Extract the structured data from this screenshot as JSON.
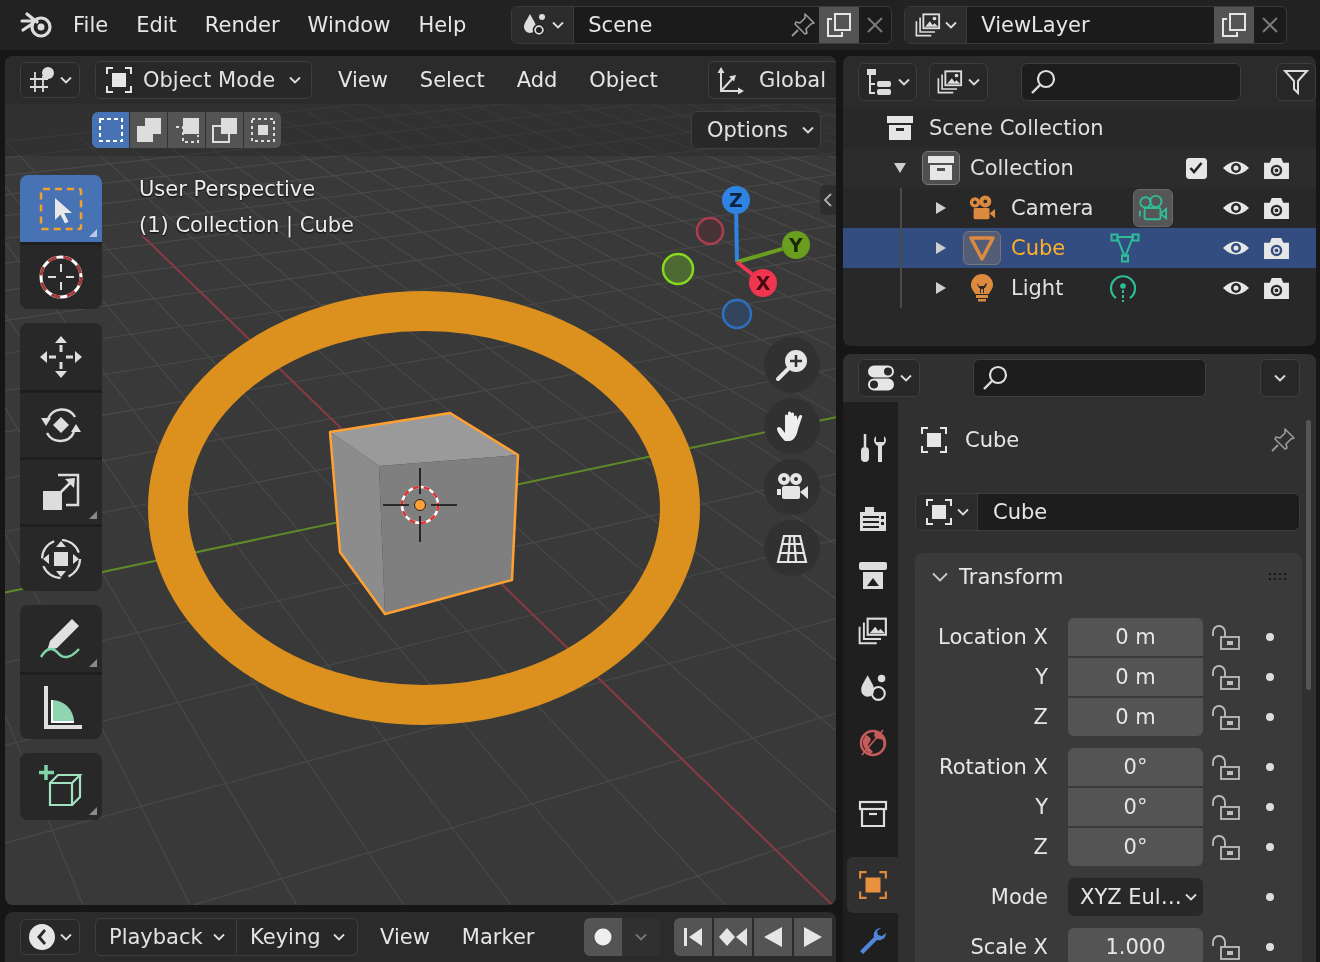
{
  "topbar": {
    "menu": [
      "File",
      "Edit",
      "Render",
      "Window",
      "Help"
    ],
    "scene": {
      "name": "Scene"
    },
    "view_layer": {
      "name": "ViewLayer"
    }
  },
  "viewport": {
    "header": {
      "mode": "Object Mode",
      "menu": [
        "View",
        "Select",
        "Add",
        "Object"
      ],
      "orientation": "Global"
    },
    "select_modes": [
      {
        "kind": "set",
        "selected": true
      },
      {
        "kind": "extend",
        "selected": false
      },
      {
        "kind": "subtract",
        "selected": false
      },
      {
        "kind": "invert",
        "selected": false
      },
      {
        "kind": "intersect",
        "selected": false
      }
    ],
    "options": "Options",
    "view_name": "User Perspective",
    "object_info": "(1) Collection | Cube",
    "tool_groups": [
      {
        "tools": [
          {
            "kind": "select_box",
            "selected": true,
            "more": true
          },
          {
            "kind": "cursor",
            "selected": false,
            "more": false
          }
        ]
      },
      {
        "tools": [
          {
            "kind": "move",
            "selected": false,
            "more": false
          },
          {
            "kind": "rotate",
            "selected": false,
            "more": false
          },
          {
            "kind": "scale",
            "selected": false,
            "more": true
          },
          {
            "kind": "transform",
            "selected": false,
            "more": false
          }
        ]
      },
      {
        "tools": [
          {
            "kind": "annotate",
            "selected": false,
            "more": true
          },
          {
            "kind": "measure",
            "selected": false,
            "more": false
          }
        ]
      },
      {
        "tools": [
          {
            "kind": "add_cube",
            "selected": false,
            "more": true
          }
        ]
      }
    ],
    "gizmo": [
      {
        "kind": "z",
        "label": "Z"
      },
      {
        "kind": "y",
        "label": "Y"
      },
      {
        "kind": "x",
        "label": "X"
      }
    ]
  },
  "timeline": {
    "menus": [
      {
        "label": "Playback",
        "kind": "dropdown"
      },
      {
        "label": "Keying",
        "kind": "dropdown"
      },
      {
        "label": "View",
        "kind": "menu"
      },
      {
        "label": "Marker",
        "kind": "menu"
      }
    ],
    "auto_keying": {
      "on": false
    },
    "transport": [
      {
        "kind": "jump_start"
      },
      {
        "kind": "jump_keyframe"
      },
      {
        "kind": "play_reverse"
      },
      {
        "kind": "play"
      }
    ]
  },
  "outliner": {
    "root": {
      "label": "Scene Collection",
      "selected": false,
      "children": [
        {
          "label": "Collection",
          "kind": "collection",
          "expanded": true,
          "checked": true,
          "selected": false,
          "active": true,
          "children": [
            {
              "label": "Camera",
              "kind": "camera",
              "expanded": false,
              "selected": false,
              "active": false,
              "data_active": true
            },
            {
              "label": "Cube",
              "kind": "mesh",
              "expanded": false,
              "selected": true,
              "active": true,
              "data_active": false
            },
            {
              "label": "Light",
              "kind": "light",
              "expanded": false,
              "selected": false,
              "active": false,
              "data_active": false
            }
          ]
        }
      ]
    }
  },
  "properties": {
    "tab_groups": [
      {
        "tabs": [
          {
            "kind": "tool",
            "selected": false
          }
        ]
      },
      {
        "tabs": [
          {
            "kind": "render",
            "selected": false
          },
          {
            "kind": "output",
            "selected": false
          },
          {
            "kind": "view_layer",
            "selected": false
          },
          {
            "kind": "scene",
            "selected": false
          },
          {
            "kind": "world",
            "selected": false
          }
        ]
      },
      {
        "tabs": [
          {
            "kind": "collection",
            "selected": false
          }
        ]
      },
      {
        "tabs": [
          {
            "kind": "object",
            "selected": true
          },
          {
            "kind": "modifiers",
            "selected": false
          }
        ]
      }
    ],
    "context": "Cube",
    "name_field": "Cube",
    "panel": {
      "title": "Transform",
      "expanded": true,
      "groups": [
        {
          "rows": [
            {
              "label": "Location X",
              "value": "0 m",
              "kind": "number",
              "locked": false
            },
            {
              "label": "Y",
              "value": "0 m",
              "kind": "number",
              "locked": false
            },
            {
              "label": "Z",
              "value": "0 m",
              "kind": "number",
              "locked": false
            }
          ]
        },
        {
          "rows": [
            {
              "label": "Rotation X",
              "value": "0°",
              "kind": "number",
              "locked": false
            },
            {
              "label": "Y",
              "value": "0°",
              "kind": "number",
              "locked": false
            },
            {
              "label": "Z",
              "value": "0°",
              "kind": "number",
              "locked": false
            }
          ]
        },
        {
          "rows": [
            {
              "label": "Mode",
              "value": "XYZ Eul…",
              "kind": "dropdown"
            }
          ]
        },
        {
          "rows": [
            {
              "label": "Scale X",
              "value": "1.000",
              "kind": "number",
              "locked": false
            }
          ]
        }
      ]
    }
  }
}
